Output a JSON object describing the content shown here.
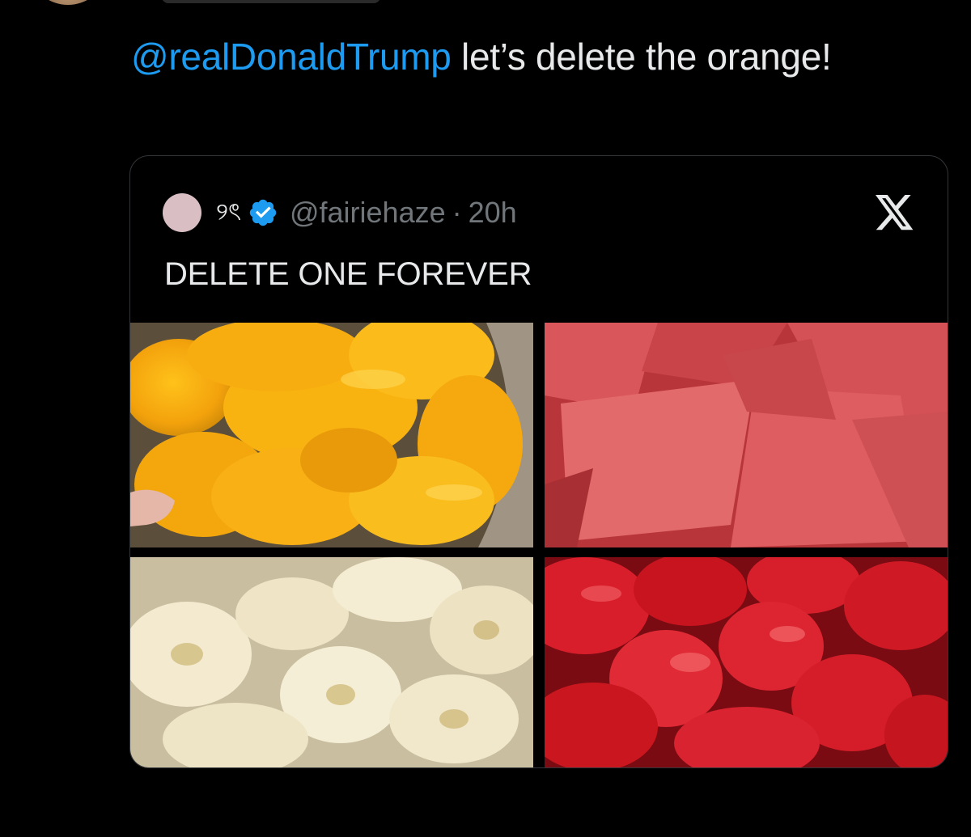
{
  "reply": {
    "mention": "@realDonaldTrump",
    "text": " let’s delete the orange!"
  },
  "quoted_tweet": {
    "display_name": "୨ৎ",
    "verified": true,
    "handle": "@fairiehaze",
    "separator": "·",
    "time": "20h",
    "text": "DELETE ONE FOREVER",
    "avatar_color": "#d9bfc4",
    "logo_icon": "x-logo-icon",
    "verified_icon": "verified-badge-icon",
    "media": [
      {
        "subject": "mango-slices-photo"
      },
      {
        "subject": "watermelon-chunks-photo"
      },
      {
        "subject": "banana-slices-photo"
      },
      {
        "subject": "strawberries-photo"
      }
    ]
  },
  "colors": {
    "background": "#000000",
    "mention": "#1d9bf0",
    "text": "#e7e9ea",
    "muted": "#71767b",
    "border": "#333639",
    "verified": "#1d9bf0"
  }
}
